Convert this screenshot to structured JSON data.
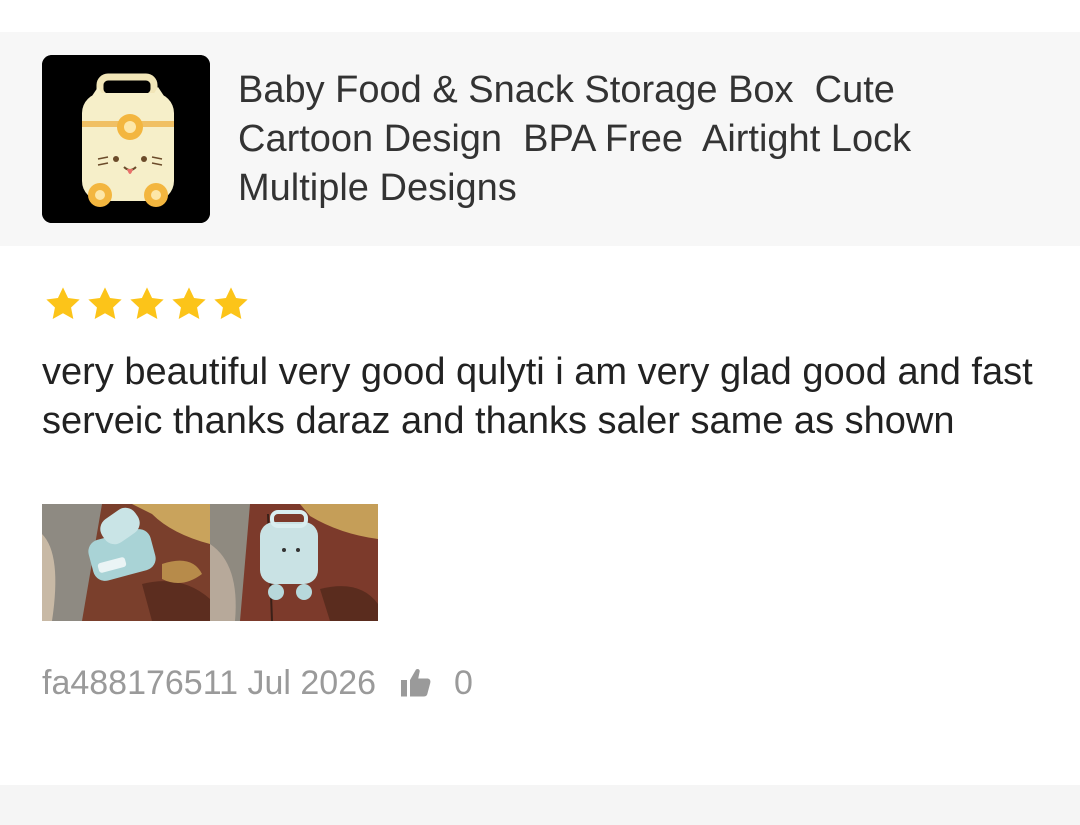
{
  "product": {
    "title": "Baby Food & Snack Storage Box  Cute Cartoon Design  BPA Free  Airtight Lock Multiple Designs",
    "thumbnail_icon": "baby-food-box-image"
  },
  "review": {
    "rating": 5,
    "rating_max": 5,
    "text": "very beautiful very good qulyti i am very glad good and fast serveic thanks daraz and thanks saler same as shown",
    "photos": [
      "review-photo-1",
      "review-photo-2"
    ],
    "author_date": "fa488176511 Jul 2026",
    "like_icon": "thumbs-up-icon",
    "likes": "0"
  },
  "colors": {
    "star": "#fcc419",
    "meta_text": "#9a9a9a",
    "header_bg": "#f7f7f7"
  }
}
